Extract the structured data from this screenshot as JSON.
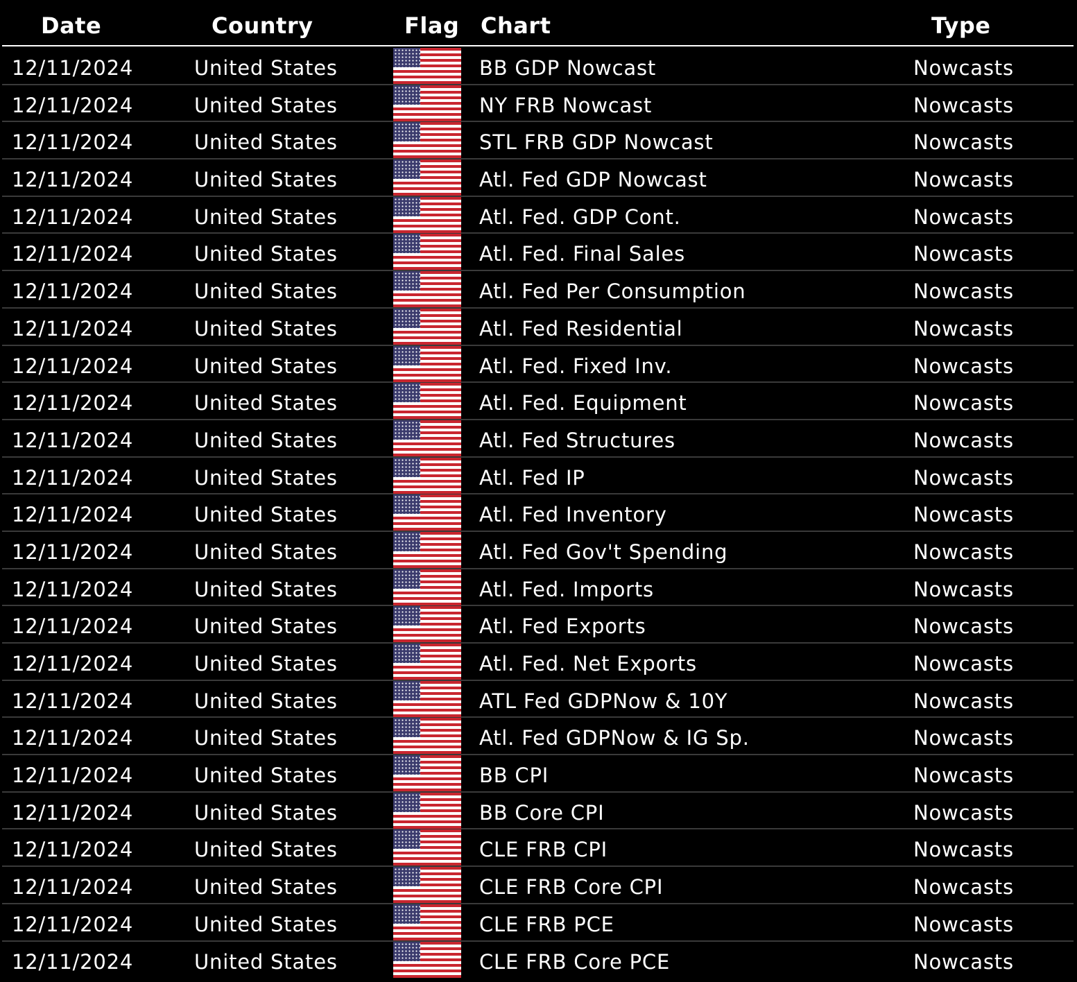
{
  "table": {
    "headers": {
      "date": "Date",
      "country": "Country",
      "flag": "Flag",
      "chart": "Chart",
      "type": "Type"
    },
    "flag_icon": "us-flag-icon",
    "colors": {
      "background": "#000000",
      "text": "#ffffff",
      "flag_red": "#c9262f",
      "flag_blue": "#3b3b6d"
    },
    "rows": [
      {
        "date": "12/11/2024",
        "country": "United States",
        "chart": "BB GDP Nowcast",
        "type": "Nowcasts"
      },
      {
        "date": "12/11/2024",
        "country": "United States",
        "chart": "NY FRB Nowcast",
        "type": "Nowcasts"
      },
      {
        "date": "12/11/2024",
        "country": "United States",
        "chart": "STL FRB GDP Nowcast",
        "type": "Nowcasts"
      },
      {
        "date": "12/11/2024",
        "country": "United States",
        "chart": "Atl. Fed GDP Nowcast",
        "type": "Nowcasts"
      },
      {
        "date": "12/11/2024",
        "country": "United States",
        "chart": "Atl. Fed. GDP Cont.",
        "type": "Nowcasts"
      },
      {
        "date": "12/11/2024",
        "country": "United States",
        "chart": "Atl. Fed. Final Sales",
        "type": "Nowcasts"
      },
      {
        "date": "12/11/2024",
        "country": "United States",
        "chart": "Atl. Fed Per Consumption",
        "type": "Nowcasts"
      },
      {
        "date": "12/11/2024",
        "country": "United States",
        "chart": "Atl. Fed Residential",
        "type": "Nowcasts"
      },
      {
        "date": "12/11/2024",
        "country": "United States",
        "chart": "Atl. Fed. Fixed Inv.",
        "type": "Nowcasts"
      },
      {
        "date": "12/11/2024",
        "country": "United States",
        "chart": "Atl. Fed. Equipment",
        "type": "Nowcasts"
      },
      {
        "date": "12/11/2024",
        "country": "United States",
        "chart": "Atl. Fed Structures",
        "type": "Nowcasts"
      },
      {
        "date": "12/11/2024",
        "country": "United States",
        "chart": "Atl. Fed IP",
        "type": "Nowcasts"
      },
      {
        "date": "12/11/2024",
        "country": "United States",
        "chart": "Atl. Fed Inventory",
        "type": "Nowcasts"
      },
      {
        "date": "12/11/2024",
        "country": "United States",
        "chart": "Atl. Fed Gov't Spending",
        "type": "Nowcasts"
      },
      {
        "date": "12/11/2024",
        "country": "United States",
        "chart": "Atl. Fed. Imports",
        "type": "Nowcasts"
      },
      {
        "date": "12/11/2024",
        "country": "United States",
        "chart": "Atl. Fed Exports",
        "type": "Nowcasts"
      },
      {
        "date": "12/11/2024",
        "country": "United States",
        "chart": "Atl. Fed. Net Exports",
        "type": "Nowcasts"
      },
      {
        "date": "12/11/2024",
        "country": "United States",
        "chart": "ATL Fed GDPNow & 10Y",
        "type": "Nowcasts"
      },
      {
        "date": "12/11/2024",
        "country": "United States",
        "chart": "Atl. Fed GDPNow & IG Sp.",
        "type": "Nowcasts"
      },
      {
        "date": "12/11/2024",
        "country": "United States",
        "chart": "BB CPI",
        "type": "Nowcasts"
      },
      {
        "date": "12/11/2024",
        "country": "United States",
        "chart": "BB Core CPI",
        "type": "Nowcasts"
      },
      {
        "date": "12/11/2024",
        "country": "United States",
        "chart": "CLE FRB CPI",
        "type": "Nowcasts"
      },
      {
        "date": "12/11/2024",
        "country": "United States",
        "chart": "CLE FRB Core CPI",
        "type": "Nowcasts"
      },
      {
        "date": "12/11/2024",
        "country": "United States",
        "chart": "CLE FRB PCE",
        "type": "Nowcasts"
      },
      {
        "date": "12/11/2024",
        "country": "United States",
        "chart": "CLE FRB Core PCE",
        "type": "Nowcasts"
      }
    ]
  }
}
